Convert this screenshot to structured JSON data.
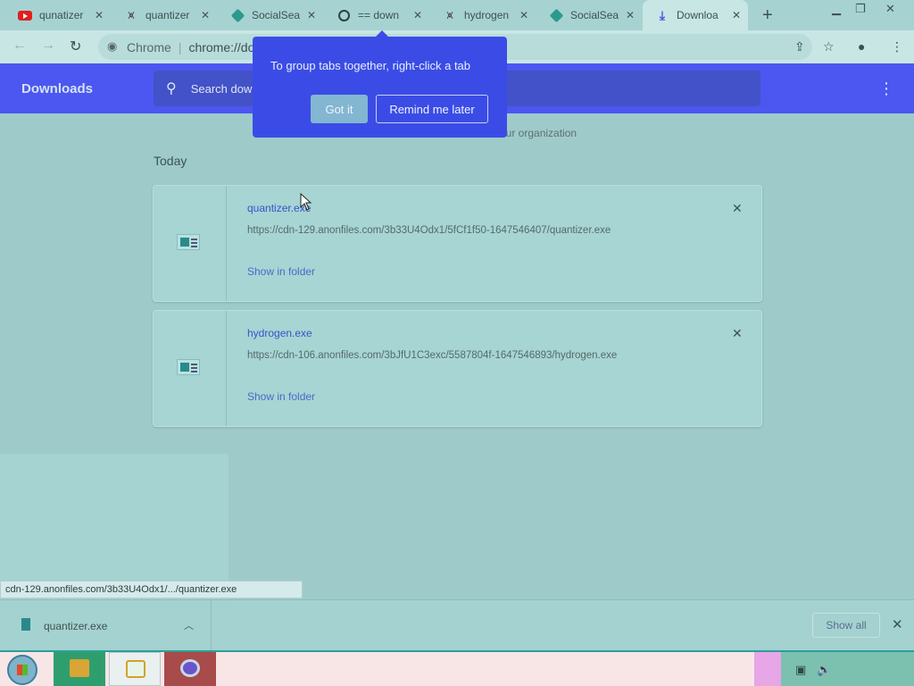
{
  "tabs": [
    {
      "title": "qunatizer",
      "icon": "youtube-icon",
      "active": false
    },
    {
      "title": "quantizer",
      "icon": "huggingface-icon",
      "active": false
    },
    {
      "title": "SocialSea",
      "icon": "socialsea-icon",
      "active": false
    },
    {
      "title": "== down",
      "icon": "globe-icon",
      "active": false
    },
    {
      "title": "hydrogen",
      "icon": "huggingface-icon",
      "active": false
    },
    {
      "title": "SocialSea",
      "icon": "socialsea-icon",
      "active": false
    },
    {
      "title": "Downloa",
      "icon": "download-icon",
      "active": true
    }
  ],
  "toolbar": {
    "site_label": "Chrome",
    "url": "chrome://do"
  },
  "header": {
    "title": "Downloads",
    "search_placeholder": "Search dow"
  },
  "popup": {
    "text": "To group tabs together, right-click a tab",
    "got_it": "Got it",
    "remind": "Remind me later"
  },
  "managed_text": "our organization",
  "section_label": "Today",
  "downloads": [
    {
      "name": "quantizer.exe",
      "url": "https://cdn-129.anonfiles.com/3b33U4Odx1/5fCf1f50-1647546407/quantizer.exe",
      "action": "Show in folder"
    },
    {
      "name": "hydrogen.exe",
      "url": "https://cdn-106.anonfiles.com/3bJfU1C3exc/5587804f-1647546893/hydrogen.exe",
      "action": "Show in folder"
    }
  ],
  "status_url": "cdn-129.anonfiles.com/3b33U4Odx1/.../quantizer.exe",
  "shelf": {
    "file": "quantizer.exe",
    "show_all": "Show all"
  },
  "colors": {
    "accent": "#4b57f0",
    "page_bg": "#9ecbca",
    "popup_bg": "#3b4ce6"
  }
}
